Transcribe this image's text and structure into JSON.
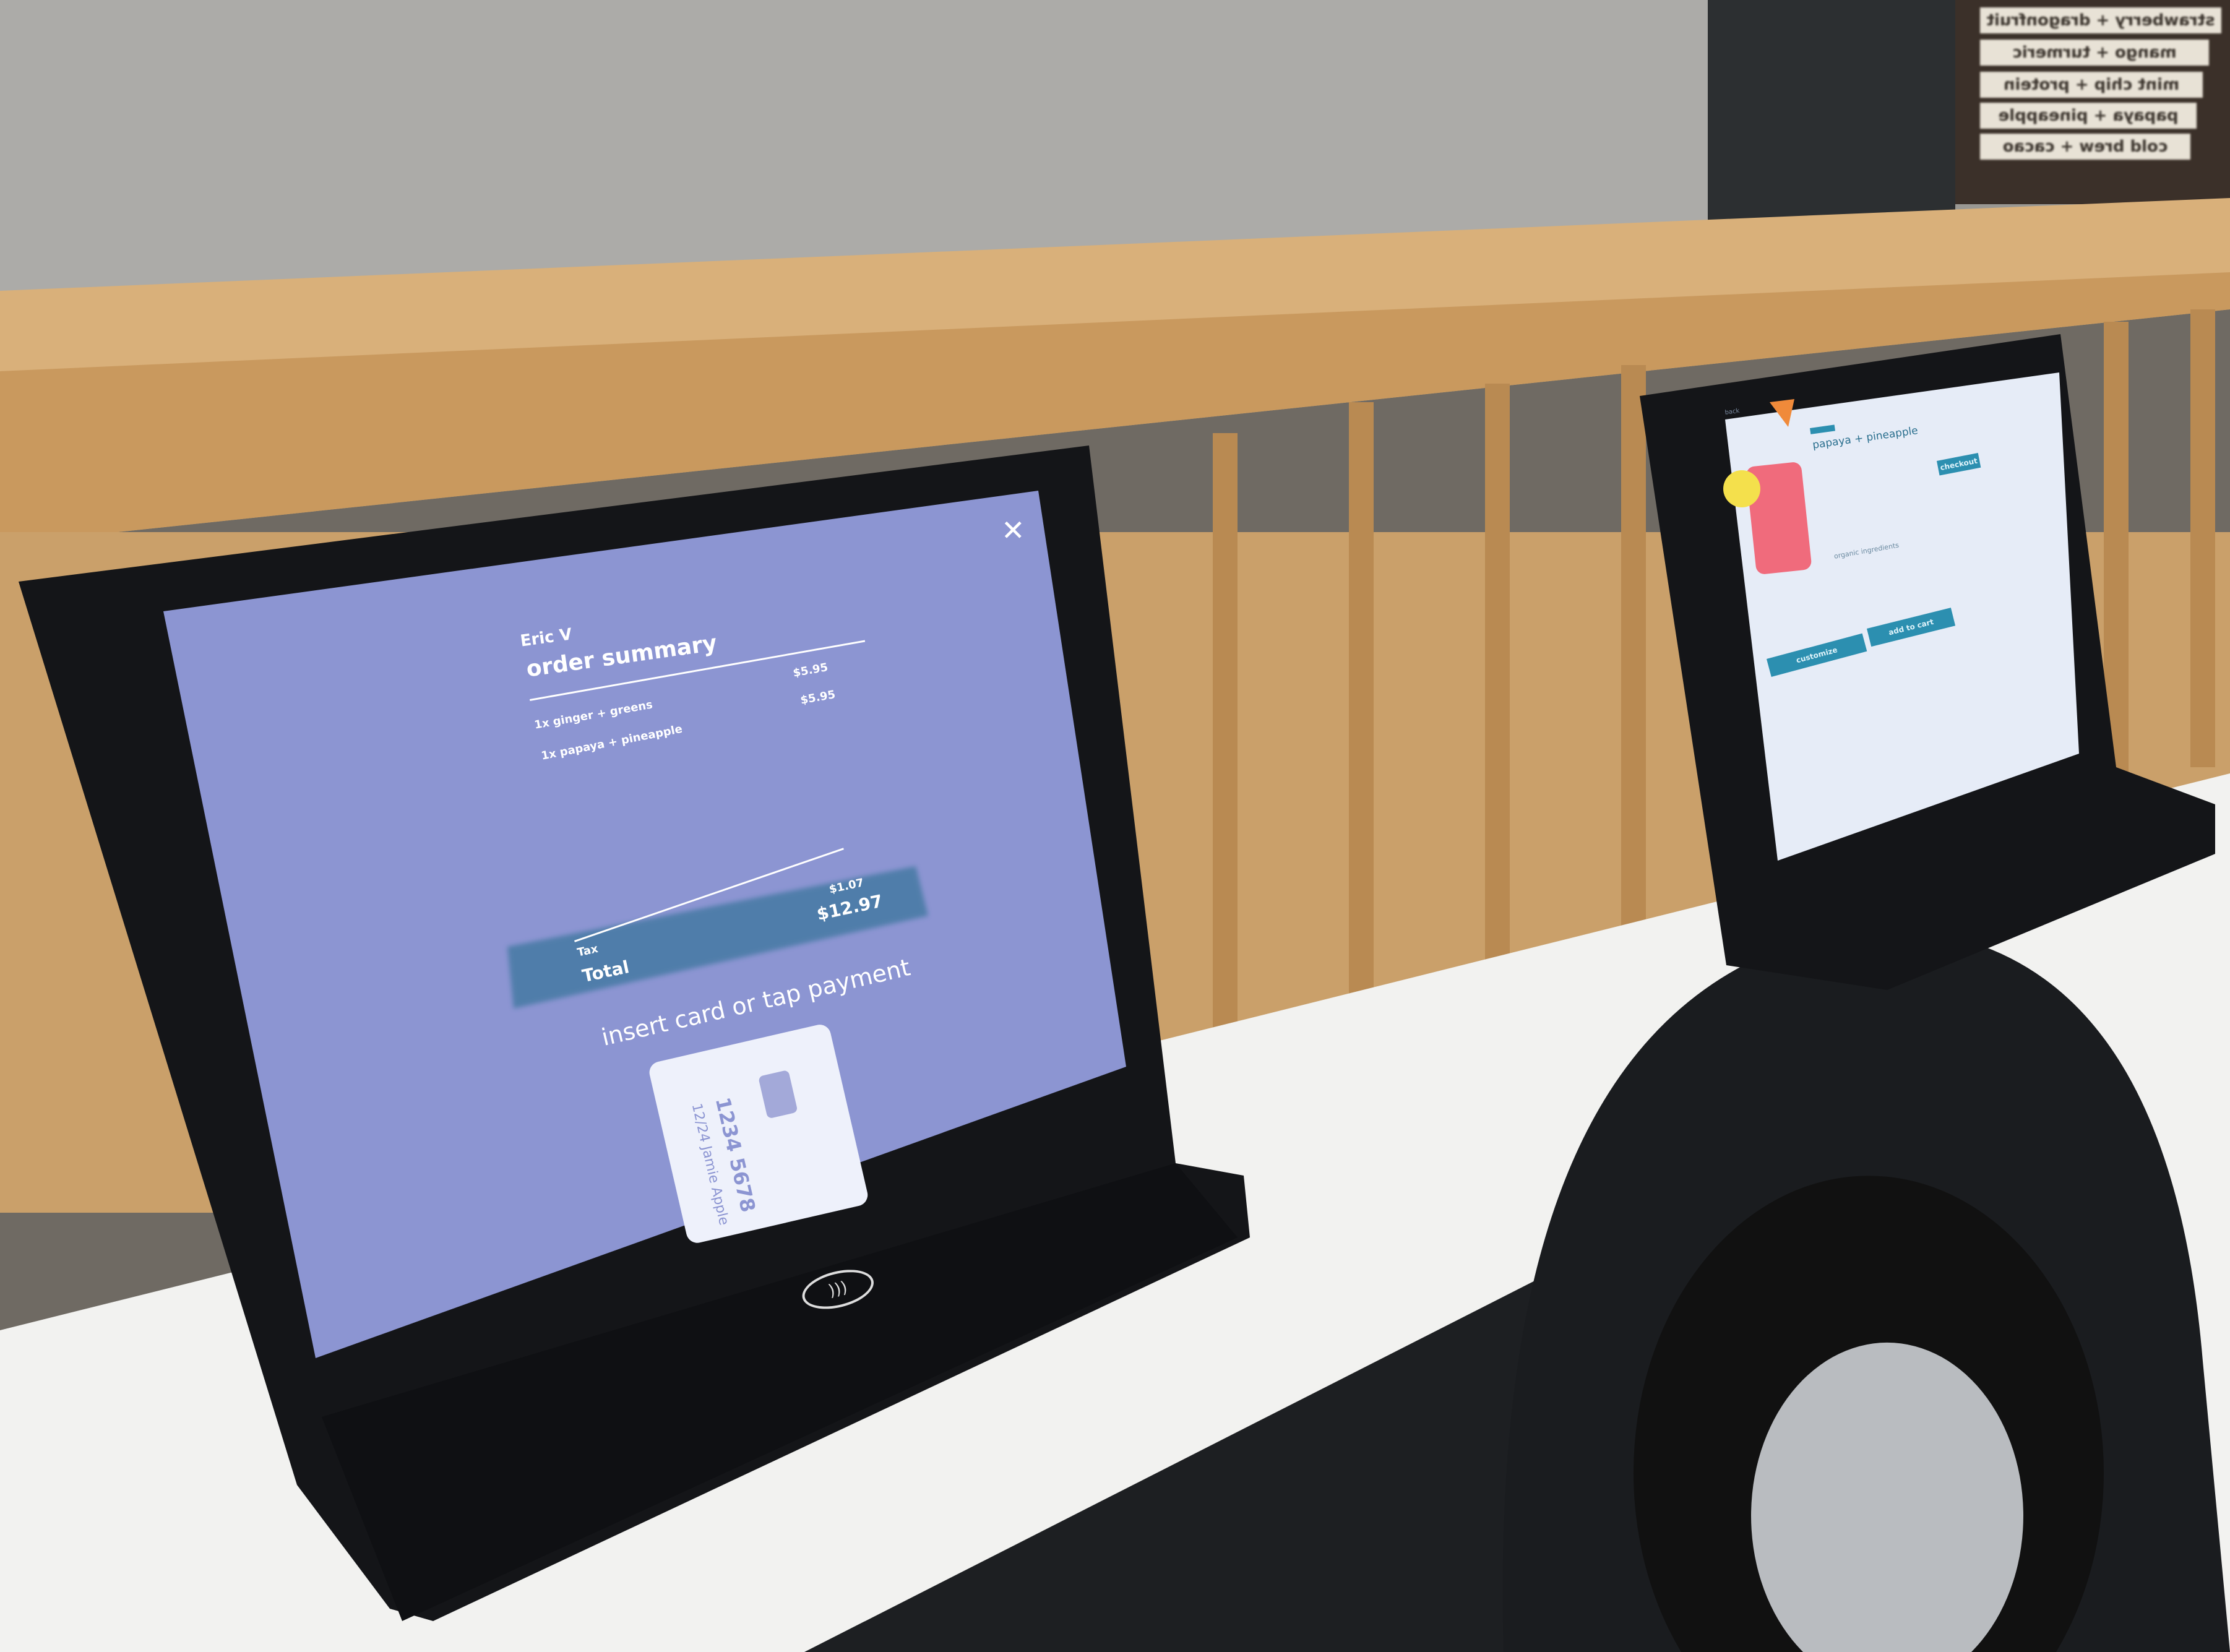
{
  "background_signs": [
    "strawberry + dragonfruit",
    "mango + turmeric",
    "mint chip + protein",
    "papaya + pineapple",
    "cold brew + cacao"
  ],
  "left_kiosk": {
    "customer_name": "Eric V",
    "title": "order summary",
    "items": [
      {
        "qty": "1x",
        "name": "ginger + greens",
        "price": "$5.95"
      },
      {
        "qty": "1x",
        "name": "papaya + pineapple",
        "price": "$5.95"
      }
    ],
    "tax_label": "Tax",
    "tax_value": "$1.07",
    "total_label": "Total",
    "total_value": "$12.97",
    "prompt": "insert card or tap payment",
    "card": {
      "number": "1234 5678",
      "details": "12/24 Jamie Apple"
    },
    "close_icon": "close-icon",
    "contactless_icon": "contactless-icon",
    "colors": {
      "screen": "#8c95d2",
      "accent": "#1f6b8a"
    }
  },
  "right_kiosk": {
    "back_label": "back",
    "product_name": "papaya + pineapple",
    "section_title": "organic ingredients",
    "checkout_label": "checkout",
    "customize_label": "customize",
    "add_to_cart_label": "add to cart",
    "colors": {
      "screen": "#e6ecf7",
      "accent": "#2c8fb0"
    }
  }
}
